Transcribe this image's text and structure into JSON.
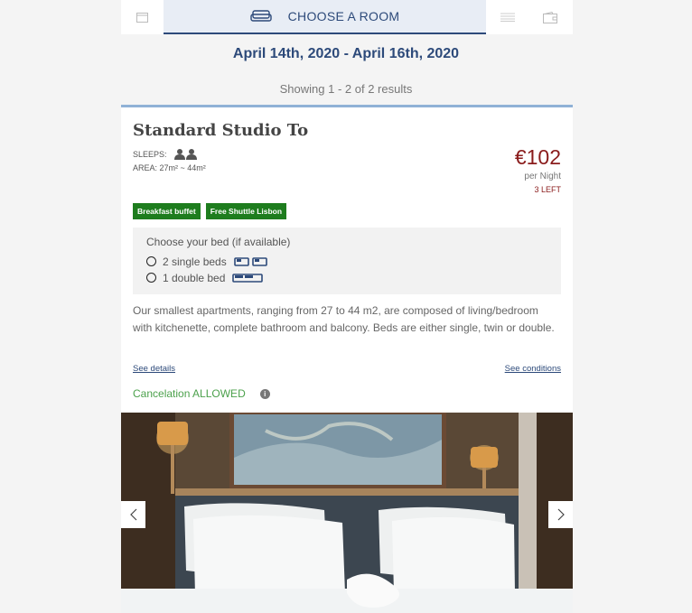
{
  "stepper": {
    "label": "CHOOSE A ROOM",
    "icons": [
      "calendar-icon",
      "sofa-icon",
      "list-icon",
      "wallet-icon"
    ]
  },
  "dates": "April 14th, 2020 - April 16th, 2020",
  "results_text": "Showing 1 - 2 of 2 results",
  "room": {
    "title": "Standard Studio To",
    "sleeps_label": "SLEEPS:",
    "area_label": "AREA: 27m² ~ 44m²",
    "price": "€102",
    "per_night": "per Night",
    "left": "3 LEFT",
    "badges": [
      "Breakfast buffet",
      "Free Shuttle Lisbon"
    ],
    "bed_question": "Choose your bed (if available)",
    "bed_options": [
      "2 single beds",
      "1 double bed"
    ],
    "description": "Our smallest apartments, ranging from 27 to 44 m2, are composed of living/bedroom with kitchenette, complete bathroom and balcony. Beds are either single, twin or double.",
    "see_details": "See details",
    "see_conditions": "See conditions",
    "cancelation": "Cancelation ALLOWED"
  },
  "colors": {
    "accent": "#2d4a7a",
    "price": "#8a1c1c",
    "badge": "#1e7d1e",
    "cancel": "#4ca14c"
  }
}
